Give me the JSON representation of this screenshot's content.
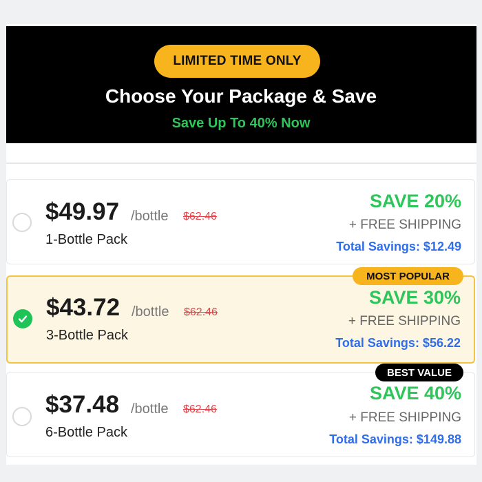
{
  "header": {
    "badge": "LIMITED TIME ONLY",
    "title": "Choose Your Package & Save",
    "subtitle": "Save Up To 40% Now"
  },
  "colors": {
    "accent_yellow": "#f7b41c",
    "green": "#2ec55a",
    "blue": "#2f6ee8",
    "strike_red": "#e0444b",
    "selected_bg": "#fdf6e3"
  },
  "options": [
    {
      "price": "$49.97",
      "per": "/bottle",
      "original": "$62.46",
      "pack": "1-Bottle Pack",
      "save": "SAVE 20%",
      "shipping": "+ FREE SHIPPING",
      "total": "Total Savings: $12.49",
      "selected": false
    },
    {
      "tag": "MOST POPULAR",
      "price": "$43.72",
      "per": "/bottle",
      "original": "$62.46",
      "pack": "3-Bottle Pack",
      "save": "SAVE 30%",
      "shipping": "+ FREE SHIPPING",
      "total": "Total Savings: $56.22",
      "selected": true
    },
    {
      "tag": "BEST VALUE",
      "price": "$37.48",
      "per": "/bottle",
      "original": "$62.46",
      "pack": "6-Bottle Pack",
      "save": "SAVE 40%",
      "shipping": "+ FREE SHIPPING",
      "total": "Total Savings: $149.88",
      "selected": false
    }
  ]
}
